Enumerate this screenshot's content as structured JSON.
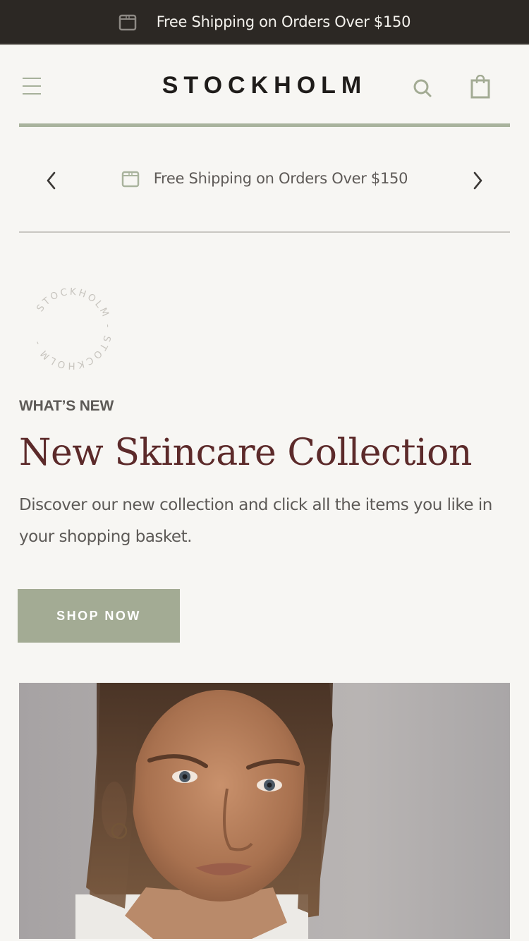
{
  "topbar": {
    "icon": "package-icon",
    "text": "Free Shipping on Orders Over $150"
  },
  "header": {
    "menu_icon": "hamburger-menu-icon",
    "logo": "STOCKHOLM",
    "search_icon": "search-icon",
    "cart_icon": "shopping-bag-icon"
  },
  "announcement": {
    "prev_icon": "chevron-left-icon",
    "next_icon": "chevron-right-icon",
    "icon": "package-icon",
    "text": "Free Shipping on Orders Over $150"
  },
  "hero_section": {
    "badge_text": "STOCKHOLM - STOCKHOLM - ",
    "eyebrow": "WHAT’S NEW",
    "title": "New Skincare Collection",
    "description": "Discover our new collection and click all the items you like in your shopping basket.",
    "cta_label": "SHOP NOW",
    "image_alt": "Portrait of woman with freckles and short wet hair"
  },
  "colors": {
    "topbar_bg": "#2c2824",
    "page_bg": "#f7f6f3",
    "accent_sage": "#a3ab94",
    "headline": "#5c2a2a",
    "body_text": "#5d5a57"
  }
}
